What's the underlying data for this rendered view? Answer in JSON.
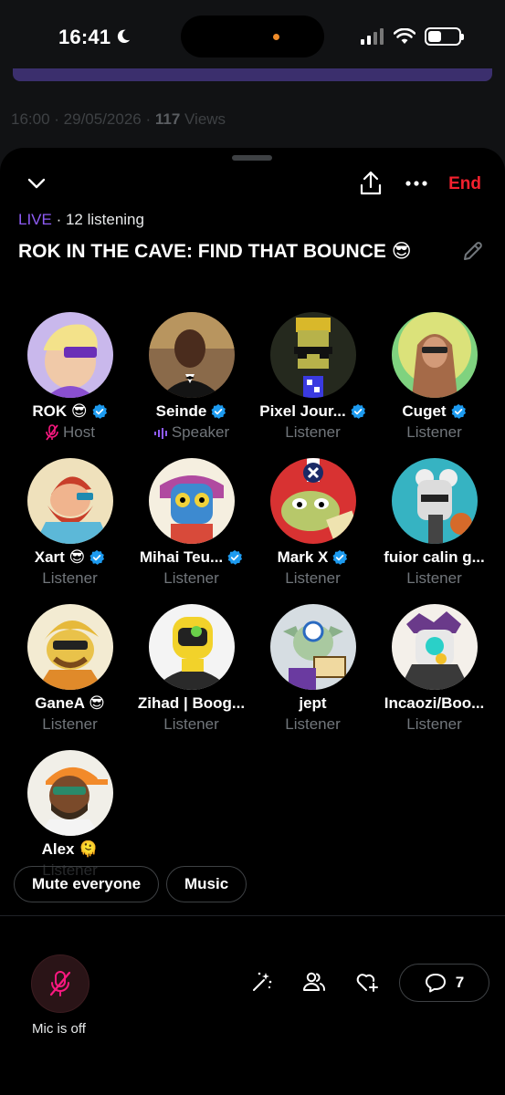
{
  "status_bar": {
    "time": "16:41",
    "battery_level": 0.45
  },
  "background": {
    "time": "16:00",
    "sep1": " · ",
    "date": "29/05/2026",
    "sep2": " · ",
    "views_count": "117",
    "views_label": " Views"
  },
  "space": {
    "live_label": "LIVE",
    "listening_text": " · 12 listening",
    "title": "ROK IN THE CAVE: FIND THAT BOUNCE 😎",
    "end_label": "End"
  },
  "participants": [
    {
      "name": "ROK 😎",
      "verified": true,
      "role": "Host"
    },
    {
      "name": "Seinde",
      "verified": true,
      "role": "Speaker"
    },
    {
      "name": "Pixel Jour...",
      "verified": true,
      "role": "Listener"
    },
    {
      "name": "Cuget",
      "verified": true,
      "role": "Listener"
    },
    {
      "name": "Xart 😎",
      "verified": true,
      "role": "Listener"
    },
    {
      "name": "Mihai Teu...",
      "verified": true,
      "role": "Listener"
    },
    {
      "name": "Mark X",
      "verified": true,
      "role": "Listener"
    },
    {
      "name": "fuior calin g...",
      "verified": false,
      "role": "Listener"
    },
    {
      "name": "GaneA 😎",
      "verified": false,
      "role": "Listener"
    },
    {
      "name": "Zihad | Boog...",
      "verified": false,
      "role": "Listener"
    },
    {
      "name": "jept",
      "verified": false,
      "role": "Listener"
    },
    {
      "name": "Incaozi/Boo...",
      "verified": false,
      "role": "Listener"
    },
    {
      "name": "Alex 🫠",
      "verified": false,
      "role": "Listener"
    }
  ],
  "actions": {
    "mute_everyone": "Mute everyone",
    "music": "Music"
  },
  "controls": {
    "mic_label": "Mic is off",
    "comments_count": "7"
  },
  "colors": {
    "accent_live": "#8f5cf6",
    "end_red": "#f4212e",
    "verified_blue": "#1d9bf0",
    "host_pink": "#f91880"
  },
  "icons": [
    "chevron-down-icon",
    "share-icon",
    "more-icon",
    "edit-icon",
    "verified-icon",
    "mic-off-icon",
    "speaker-bars-icon",
    "sparkle-wand-icon",
    "people-icon",
    "heart-plus-icon",
    "comment-icon"
  ]
}
